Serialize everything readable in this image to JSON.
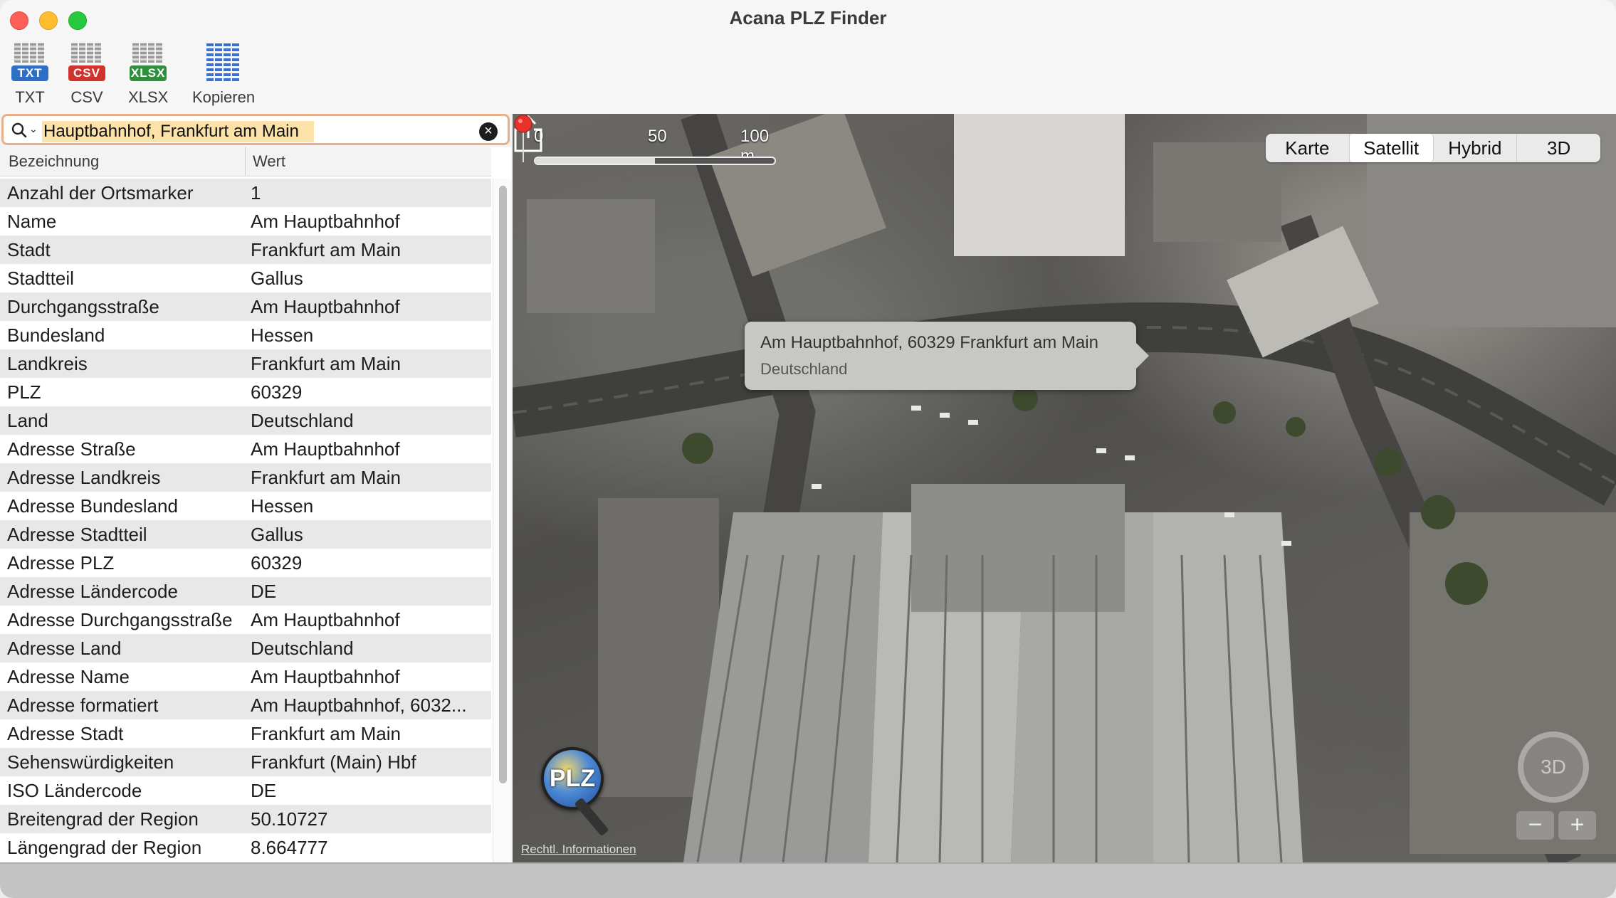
{
  "window": {
    "title": "Acana PLZ Finder"
  },
  "toolbar": {
    "txt": {
      "tag": "TXT",
      "label": "TXT"
    },
    "csv": {
      "tag": "CSV",
      "label": "CSV"
    },
    "xlsx": {
      "tag": "XLSX",
      "label": "XLSX"
    },
    "copy": {
      "label": "Kopieren"
    }
  },
  "search": {
    "value": "Hauptbahnhof, Frankfurt am Main"
  },
  "table": {
    "headers": {
      "name": "Bezeichnung",
      "value": "Wert"
    },
    "rows": [
      {
        "k": "Anzahl der Ortsmarker",
        "v": "1"
      },
      {
        "k": "Name",
        "v": "Am Hauptbahnhof"
      },
      {
        "k": "Stadt",
        "v": "Frankfurt am Main"
      },
      {
        "k": "Stadtteil",
        "v": "Gallus"
      },
      {
        "k": "Durchgangsstraße",
        "v": "Am Hauptbahnhof"
      },
      {
        "k": "Bundesland",
        "v": "Hessen"
      },
      {
        "k": "Landkreis",
        "v": "Frankfurt am Main"
      },
      {
        "k": "PLZ",
        "v": "60329"
      },
      {
        "k": "Land",
        "v": "Deutschland"
      },
      {
        "k": "Adresse Straße",
        "v": "Am Hauptbahnhof"
      },
      {
        "k": "Adresse Landkreis",
        "v": "Frankfurt am Main"
      },
      {
        "k": "Adresse Bundesland",
        "v": "Hessen"
      },
      {
        "k": "Adresse Stadtteil",
        "v": "Gallus"
      },
      {
        "k": "Adresse PLZ",
        "v": "60329"
      },
      {
        "k": "Adresse Ländercode",
        "v": "DE"
      },
      {
        "k": "Adresse Durchgangsstraße",
        "v": "Am Hauptbahnhof"
      },
      {
        "k": "Adresse Land",
        "v": "Deutschland"
      },
      {
        "k": "Adresse Name",
        "v": "Am Hauptbahnhof"
      },
      {
        "k": "Adresse formatiert",
        "v": "Am Hauptbahnhof, 6032..."
      },
      {
        "k": "Adresse Stadt",
        "v": "Frankfurt am Main"
      },
      {
        "k": "Sehenswürdigkeiten",
        "v": "Frankfurt (Main) Hbf"
      },
      {
        "k": "ISO Ländercode",
        "v": "DE"
      },
      {
        "k": "Breitengrad der Region",
        "v": "50.10727"
      },
      {
        "k": "Längengrad der Region",
        "v": "8.664777"
      }
    ]
  },
  "map": {
    "scale": {
      "s0": "0",
      "s50": "50",
      "s100": "100 m"
    },
    "modes": {
      "karte": "Karte",
      "satellit": "Satellit",
      "hybrid": "Hybrid",
      "d3": "3D"
    },
    "active_mode": "Satellit",
    "callout": {
      "line1": "Am Hauptbahnhof, 60329 Frankfurt am Main",
      "line2": "Deutschland"
    },
    "badge": "PLZ",
    "legal": "Rechtl. Informationen",
    "compass": "3D",
    "zoom_out": "−",
    "zoom_in": "+"
  }
}
